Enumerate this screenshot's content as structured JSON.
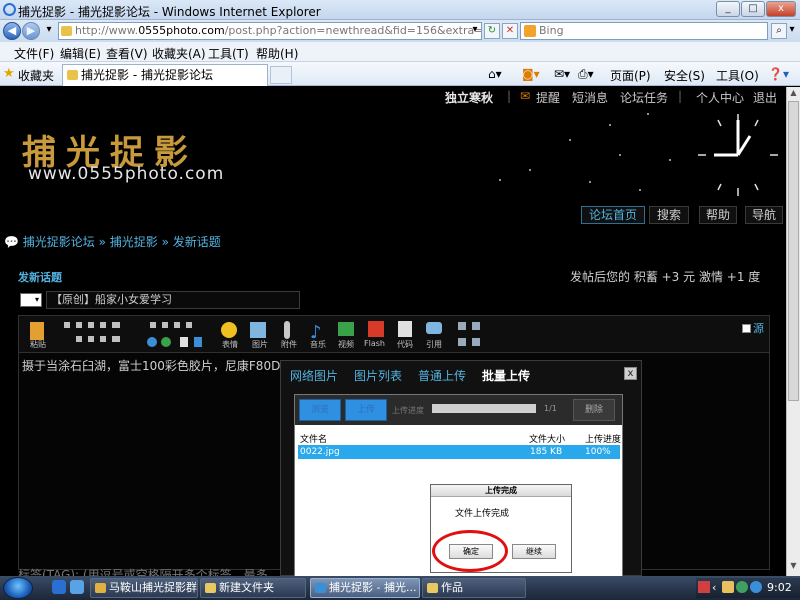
{
  "window": {
    "title": "捕光捉影 - 捕光捉影论坛 - Windows Internet Explorer",
    "minimize_glyph": "_",
    "restore_glyph": "□",
    "close_glyph": "x"
  },
  "address_bar": {
    "url_prefix": "http://www.",
    "url_host": "0555photo.com",
    "url_rest": "/post.php?action=newthread&fid=156&extra=",
    "search_placeholder": "Bing"
  },
  "menu": [
    "文件(F)",
    "编辑(E)",
    "查看(V)",
    "收藏夹(A)",
    "工具(T)",
    "帮助(H)"
  ],
  "favorites_bar": {
    "favorites_label": "收藏夹",
    "tab_title": "捕光捉影 - 捕光捉影论坛",
    "page_menu": "页面(P)",
    "safety_menu": "安全(S)",
    "tools_menu": "工具(O)"
  },
  "site": {
    "top_links": [
      "独立寒秋",
      "提醒",
      "短消息",
      "论坛任务",
      "个人中心",
      "退出"
    ],
    "logo_cn": "捕光捉影",
    "logo_url": "www.0555photo.com",
    "nav_tabs": [
      "论坛首页",
      "搜索",
      "帮助",
      "导航"
    ],
    "breadcrumb": "捕光捉影论坛 » 捕光捉影 » 发新话题",
    "section_title": "发新话题",
    "reward_text": "发帖后您的 积蓄 +3 元  激情 +1 度",
    "subject_value": "【原创】船家小女爱学习",
    "source_label": "源",
    "toolbar_labels": [
      "粘贴",
      "表情",
      "图片",
      "附件",
      "音乐",
      "视频",
      "Flash",
      "代码",
      "引用"
    ],
    "editor_text": "摄于当涂石臼湖，富士100彩色胶片，尼康F80D",
    "tags_text": "标签(TAG): (用逗号或空格隔开多个标签，最多"
  },
  "upload": {
    "tabs": [
      "网络图片",
      "图片列表",
      "普通上传",
      "批量上传"
    ],
    "active_tab": "批量上传",
    "close_glyph": "x",
    "browse_label": "浏览",
    "upload_label": "上传",
    "progress_label": "上传进度",
    "count": "1/1",
    "delete_label": "删除",
    "progress": 1.0,
    "columns": [
      "文件名",
      "文件大小",
      "上传进度"
    ],
    "rows": [
      {
        "name": "0022.jpg",
        "size": "185 KB",
        "progress": "100%"
      }
    ]
  },
  "done_dialog": {
    "title": "上传完成",
    "message": "文件上传完成",
    "ok": "确定",
    "continue": "继续"
  },
  "taskbar": {
    "items": [
      "马鞍山捕光捉影群",
      "新建文件夹",
      "捕光捉影 - 捕光...",
      "作品"
    ],
    "time": "9:02"
  },
  "colors": {
    "accent": "#53b3e0",
    "logo_gold": "#c99a3c",
    "file_row": "#2aa8ec",
    "highlight_circle": "#e01010"
  }
}
